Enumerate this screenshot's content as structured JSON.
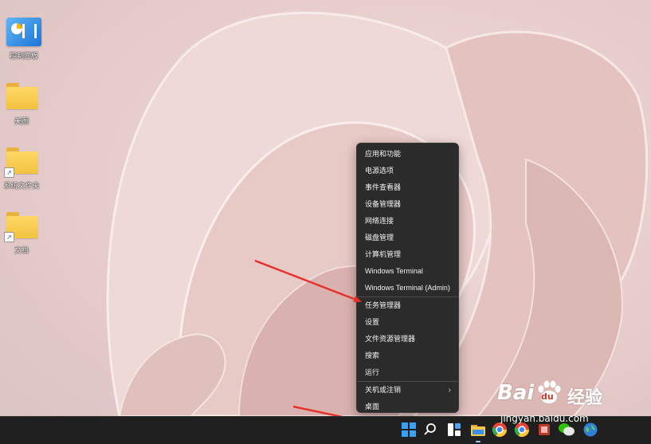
{
  "desktop": {
    "icons": [
      {
        "label": "控制面板",
        "type": "control-panel"
      },
      {
        "label": "美图",
        "type": "folder"
      },
      {
        "label": "系统文件夹",
        "type": "folder-shortcut"
      },
      {
        "label": "文档",
        "type": "folder-shortcut"
      }
    ]
  },
  "context_menu": {
    "items": [
      {
        "label": "应用和功能"
      },
      {
        "label": "电源选项"
      },
      {
        "label": "事件查看器"
      },
      {
        "label": "设备管理器"
      },
      {
        "label": "网络连接"
      },
      {
        "label": "磁盘管理"
      },
      {
        "label": "计算机管理"
      },
      {
        "label": "Windows Terminal"
      },
      {
        "label": "Windows Terminal (Admin)"
      },
      {
        "label": "任务管理器"
      },
      {
        "label": "设置"
      },
      {
        "label": "文件资源管理器"
      },
      {
        "label": "搜索"
      },
      {
        "label": "运行"
      },
      {
        "label": "关机或注销",
        "submenu_glyph": "›"
      },
      {
        "label": "桌面"
      }
    ]
  },
  "taskbar": {
    "icons": [
      "windows-start-icon",
      "search-icon",
      "widgets-icon",
      "file-explorer-icon",
      "chrome-icon",
      "chrome-icon",
      "app-icon",
      "wechat-icon",
      "globe-icon"
    ]
  },
  "watermark": {
    "brand": "Bai",
    "paw": "du",
    "cn": "经验",
    "url": "jingyan.baidu.com"
  },
  "colors": {
    "menu_bg": "#2b2b2b",
    "taskbar_bg": "#1f1f1f",
    "arrow": "#e8302a",
    "start_blue": "#3aa0f3"
  }
}
